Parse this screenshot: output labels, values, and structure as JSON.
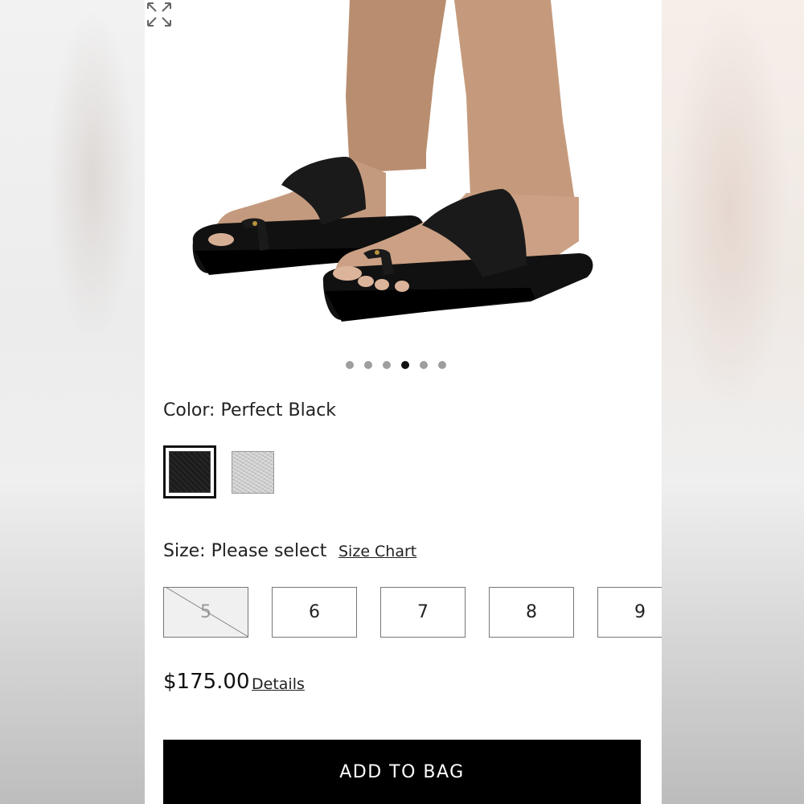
{
  "gallery": {
    "total_images": 6,
    "active_index": 3,
    "expand_icon": "expand-icon"
  },
  "color": {
    "label": "Color: Perfect Black",
    "options": [
      {
        "name": "Perfect Black",
        "hex": "#1b1b1b",
        "selected": true
      },
      {
        "name": "silver",
        "hex": "#c9c9c9",
        "selected": false
      }
    ]
  },
  "size": {
    "label": "Size: Please select",
    "chart_link": "Size Chart",
    "options": [
      {
        "label": "5",
        "available": false
      },
      {
        "label": "6",
        "available": true
      },
      {
        "label": "7",
        "available": true
      },
      {
        "label": "8",
        "available": true
      },
      {
        "label": "9",
        "available": true
      }
    ]
  },
  "price": {
    "amount": "$175.00",
    "details_link": "Details"
  },
  "cta": {
    "add_to_bag": "ADD TO BAG"
  },
  "colors": {
    "primary": "#000000",
    "background": "#ffffff"
  }
}
